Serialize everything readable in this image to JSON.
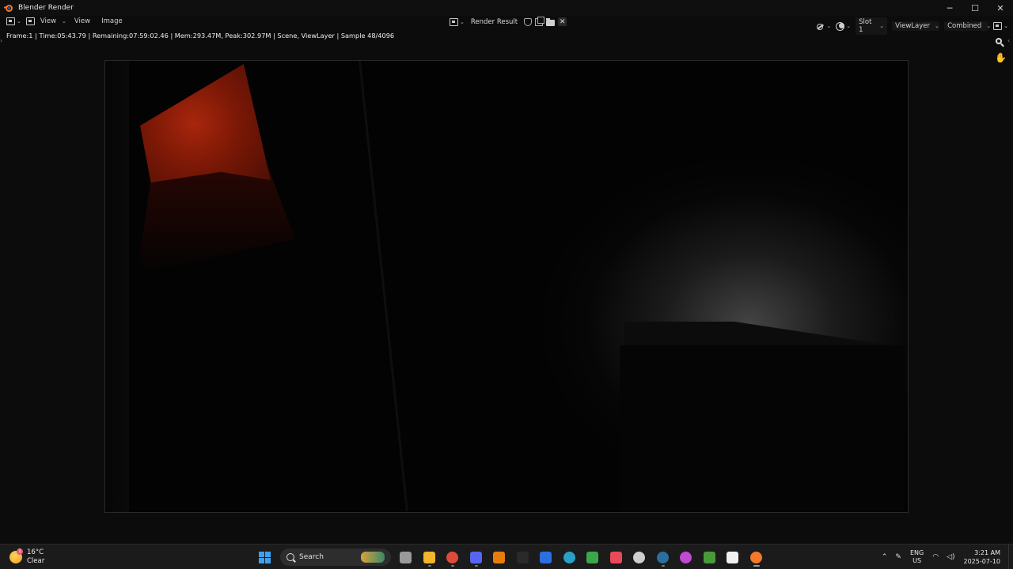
{
  "window": {
    "title": "Blender Render",
    "controls": {
      "minimize": "─",
      "maximize": "☐",
      "close": "✕"
    }
  },
  "header": {
    "view_select_label": "View",
    "menus": [
      "View",
      "Image"
    ],
    "image_name": "Render Result",
    "slot": "Slot 1",
    "view_layer": "ViewLayer",
    "pass": "Combined"
  },
  "stats": {
    "text": "Frame:1 | Time:05:43.79 | Remaining:07:59:02.46 | Mem:293.47M, Peak:302.97M | Scene, ViewLayer | Sample 48/4096"
  },
  "taskbar": {
    "weather": {
      "temp": "16°C",
      "condition": "Clear",
      "badge": "1"
    },
    "search_label": "Search",
    "apps": [
      {
        "name": "task-view",
        "color": "#9a9a9a"
      },
      {
        "name": "file-explorer",
        "color": "#f2b52b"
      },
      {
        "name": "chrome",
        "color": "#e04a3a"
      },
      {
        "name": "discord",
        "color": "#5865f2"
      },
      {
        "name": "blender-alt",
        "color": "#e87d0d"
      },
      {
        "name": "epic-games",
        "color": "#2a2a2a"
      },
      {
        "name": "roblox-studio",
        "color": "#2b6fe0"
      },
      {
        "name": "browser-globe",
        "color": "#2aa0c8"
      },
      {
        "name": "tree-app",
        "color": "#3aa84a"
      },
      {
        "name": "valorant",
        "color": "#e84a5a"
      },
      {
        "name": "github-like",
        "color": "#cfcfcf"
      },
      {
        "name": "steam",
        "color": "#2a6fa0"
      },
      {
        "name": "color-app",
        "color": "#c04ad0"
      },
      {
        "name": "minecraft",
        "color": "#4a9a3a"
      },
      {
        "name": "capcut",
        "color": "#f0f0f0"
      },
      {
        "name": "blender",
        "color": "#f5792a"
      }
    ],
    "tray": {
      "lang_top": "ENG",
      "lang_bottom": "US",
      "time": "3:21 AM",
      "date": "2025-07-10"
    }
  }
}
